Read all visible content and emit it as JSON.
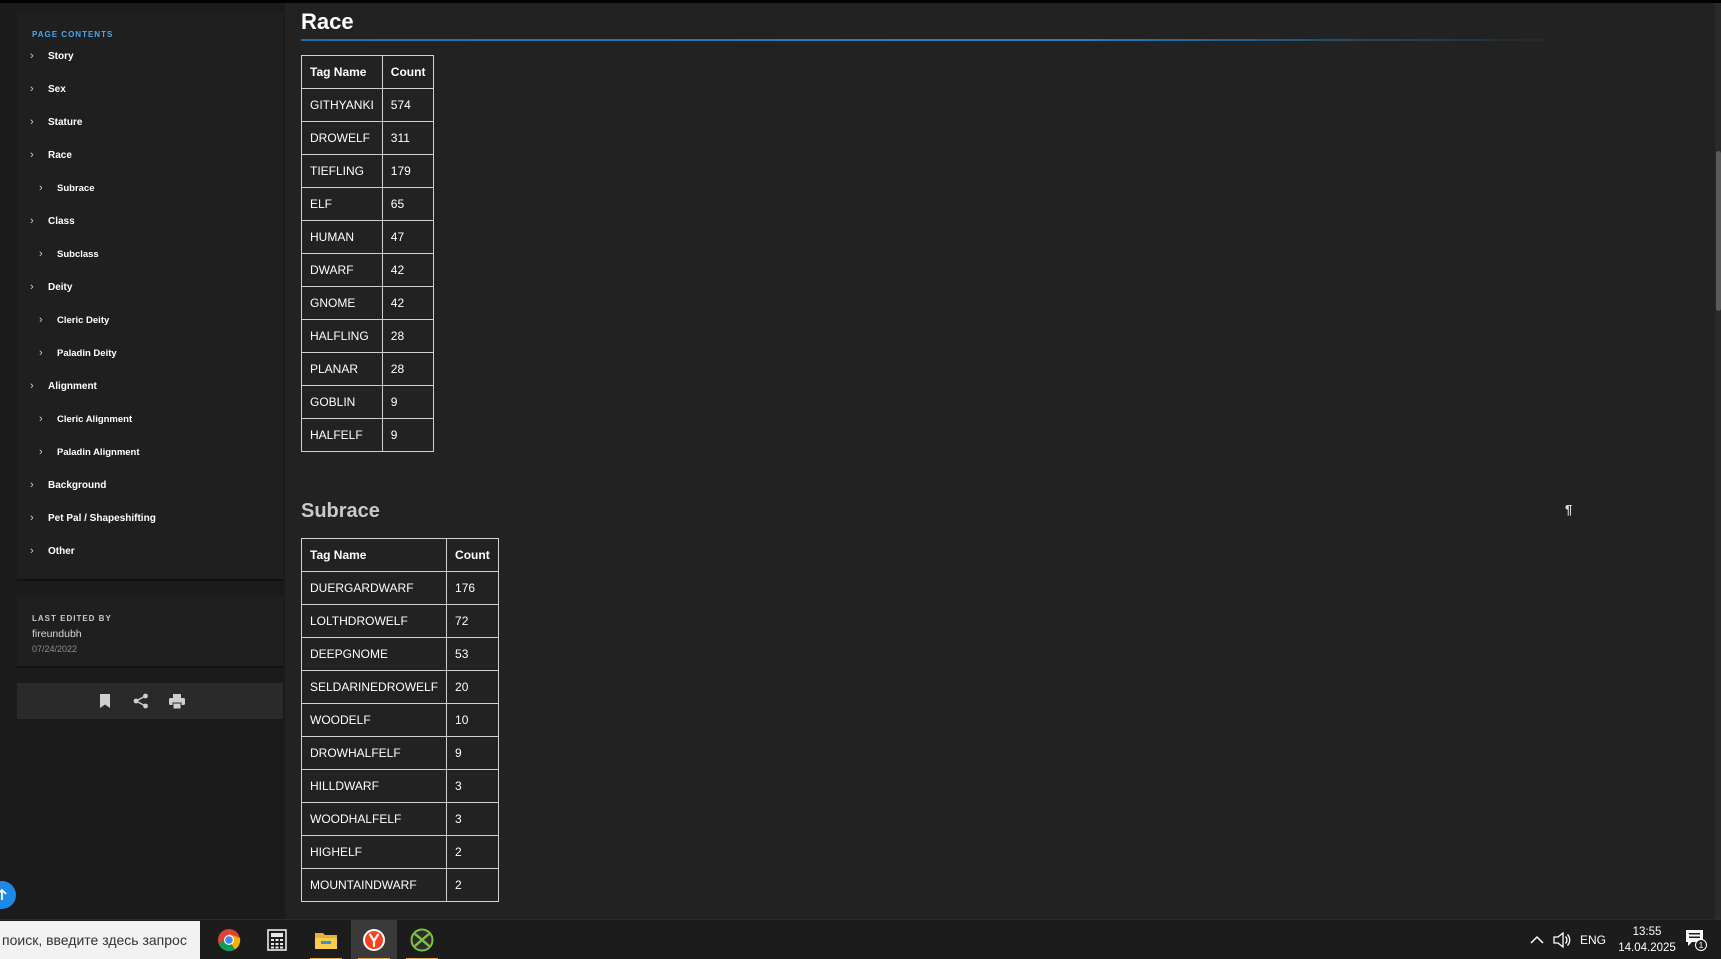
{
  "sidebar": {
    "toc_heading": "PAGE CONTENTS",
    "toc_items": [
      {
        "label": "Story",
        "level": 1
      },
      {
        "label": "Sex",
        "level": 1
      },
      {
        "label": "Stature",
        "level": 1
      },
      {
        "label": "Race",
        "level": 1
      },
      {
        "label": "Subrace",
        "level": 2
      },
      {
        "label": "Class",
        "level": 1
      },
      {
        "label": "Subclass",
        "level": 2
      },
      {
        "label": "Deity",
        "level": 1
      },
      {
        "label": "Cleric Deity",
        "level": 2
      },
      {
        "label": "Paladin Deity",
        "level": 2
      },
      {
        "label": "Alignment",
        "level": 1
      },
      {
        "label": "Cleric Alignment",
        "level": 2
      },
      {
        "label": "Paladin Alignment",
        "level": 2
      },
      {
        "label": "Background",
        "level": 1
      },
      {
        "label": "Pet Pal / Shapeshifting",
        "level": 1
      },
      {
        "label": "Other",
        "level": 1
      }
    ],
    "last_edited_label": "LAST EDITED BY",
    "last_edited_user": "fireundubh",
    "last_edited_date": "07/24/2022",
    "action_icons": [
      "bookmark-icon",
      "share-icon",
      "print-icon"
    ]
  },
  "content": {
    "race_heading": "Race",
    "race_table": {
      "headers": [
        "Tag Name",
        "Count"
      ],
      "rows": [
        [
          "GITHYANKI",
          "574"
        ],
        [
          "DROWELF",
          "311"
        ],
        [
          "TIEFLING",
          "179"
        ],
        [
          "ELF",
          "65"
        ],
        [
          "HUMAN",
          "47"
        ],
        [
          "DWARF",
          "42"
        ],
        [
          "GNOME",
          "42"
        ],
        [
          "HALFLING",
          "28"
        ],
        [
          "PLANAR",
          "28"
        ],
        [
          "GOBLIN",
          "9"
        ],
        [
          "HALFELF",
          "9"
        ]
      ]
    },
    "subrace_heading": "Subrace",
    "pilcrow": "¶",
    "subrace_table": {
      "headers": [
        "Tag Name",
        "Count"
      ],
      "rows": [
        [
          "DUERGARDWARF",
          "176"
        ],
        [
          "LOLTHDROWELF",
          "72"
        ],
        [
          "DEEPGNOME",
          "53"
        ],
        [
          "SELDARINEDROWELF",
          "20"
        ],
        [
          "WOODELF",
          "10"
        ],
        [
          "DROWHALFELF",
          "9"
        ],
        [
          "HILLDWARF",
          "3"
        ],
        [
          "WOODHALFELF",
          "3"
        ],
        [
          "HIGHELF",
          "2"
        ],
        [
          "MOUNTAINDWARF",
          "2"
        ]
      ]
    }
  },
  "taskbar": {
    "search_placeholder": "поиск, введите здесь запрос",
    "apps": [
      "chrome-icon",
      "calculator-icon",
      "file-explorer-icon",
      "yandex-browser-icon",
      "xbox-icon"
    ],
    "language": "ENG",
    "time": "13:55",
    "date": "14.04.2025",
    "notification_count": "1"
  },
  "colors": {
    "accent": "#4fa6e6",
    "background": "#222222",
    "sidebar": "#1b1b1b",
    "panel": "#1f1f1f",
    "heading_rule": "#1e6fb0",
    "scroll_top_button": "#1e88e5"
  }
}
